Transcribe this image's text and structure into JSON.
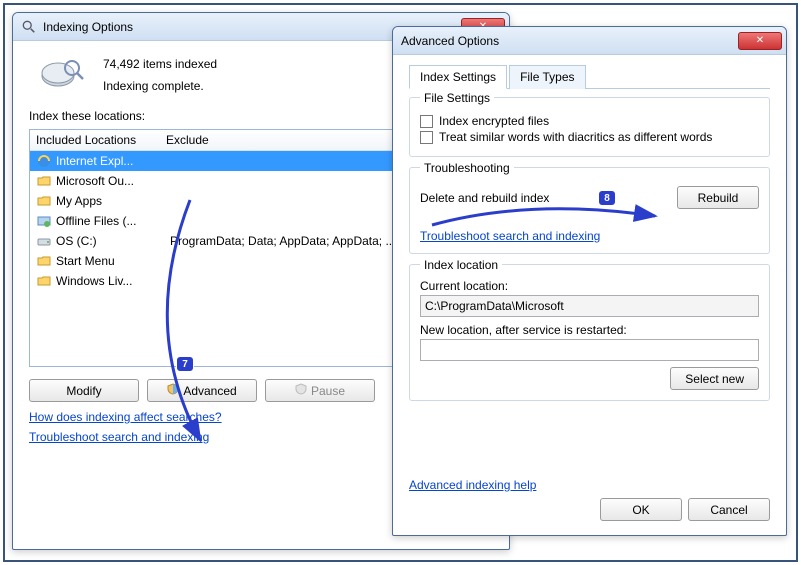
{
  "indexing_window": {
    "title": "Indexing Options",
    "items_indexed": "74,492 items indexed",
    "status": "Indexing complete.",
    "locations_label": "Index these locations:",
    "col_included": "Included Locations",
    "col_exclude": "Exclude",
    "rows": [
      {
        "icon": "ie-icon",
        "name": "Internet Expl...",
        "exclude": ""
      },
      {
        "icon": "folder-icon",
        "name": "Microsoft Ou...",
        "exclude": ""
      },
      {
        "icon": "folder-icon",
        "name": "My Apps",
        "exclude": ""
      },
      {
        "icon": "offline-icon",
        "name": "Offline Files (...",
        "exclude": ""
      },
      {
        "icon": "drive-icon",
        "name": "OS (C:)",
        "exclude": "ProgramData; Data; AppData; AppData; ..."
      },
      {
        "icon": "folder-icon",
        "name": "Start Menu",
        "exclude": ""
      },
      {
        "icon": "folder-icon",
        "name": "Windows Liv...",
        "exclude": ""
      }
    ],
    "btn_modify": "Modify",
    "btn_advanced": "Advanced",
    "btn_pause": "Pause",
    "link_affect": "How does indexing affect searches?",
    "link_troubleshoot": "Troubleshoot search and indexing"
  },
  "advanced_window": {
    "title": "Advanced Options",
    "tab_index": "Index Settings",
    "tab_filetypes": "File Types",
    "fs_label": "File Settings",
    "chk_encrypted": "Index encrypted files",
    "chk_diacritics": "Treat similar words with diacritics as different words",
    "ts_label": "Troubleshooting",
    "ts_text": "Delete and rebuild index",
    "btn_rebuild": "Rebuild",
    "link_ts": "Troubleshoot search and indexing",
    "il_label": "Index location",
    "il_current_label": "Current location:",
    "il_current_value": "C:\\ProgramData\\Microsoft",
    "il_new_label": "New location, after service is restarted:",
    "btn_select_new": "Select new",
    "link_help": "Advanced indexing help",
    "btn_ok": "OK",
    "btn_cancel": "Cancel"
  },
  "annotations": {
    "badge7": "7",
    "badge8": "8"
  }
}
